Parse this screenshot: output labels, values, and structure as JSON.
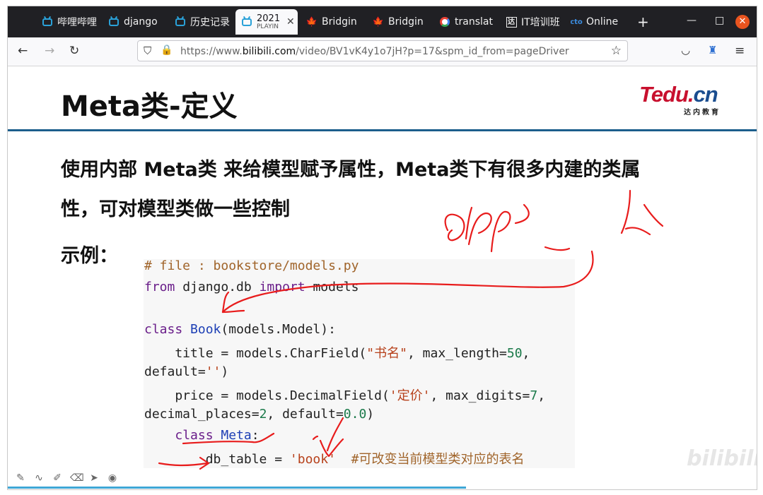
{
  "browser": {
    "tabs": [
      {
        "label": "哔哩哔哩",
        "icon": "bilibili-icon"
      },
      {
        "label": "django",
        "icon": "bilibili-icon"
      },
      {
        "label": "历史记录",
        "icon": "bilibili-icon"
      },
      {
        "label": "2021",
        "sublabel": "PLAYIN",
        "icon": "bilibili-icon",
        "active": true
      },
      {
        "label": "Bridgin",
        "icon": "maple-leaf-icon"
      },
      {
        "label": "Bridgin",
        "icon": "maple-leaf-icon"
      },
      {
        "label": "translat",
        "icon": "google-icon"
      },
      {
        "label": "IT培训班",
        "icon": "tarena-icon"
      },
      {
        "label": "Online",
        "icon": "cto-icon"
      }
    ],
    "new_tab": "+",
    "url_prefix": "https://www.",
    "url_domain": "bilibili.com",
    "url_path": "/video/BV1vK4y1o7jH?p=17&spm_id_from=pageDriver"
  },
  "slide": {
    "title": "Meta类-定义",
    "logo_main": "Tedu.",
    "logo_cn": "cn",
    "logo_sub": "达内教育",
    "para_line1": "使用内部 Meta类 来给模型赋予属性，Meta类下有很多内建的类属",
    "para_line2": "性，可对模型类做一些控制",
    "example_label": "示例：",
    "code": {
      "l1": "# file : bookstore/models.py",
      "l2_kw1": "from",
      "l2_mid": " django.db ",
      "l2_kw2": "import",
      "l2_end": " models",
      "l4_kw": "class",
      "l4_fn": "Book",
      "l4_end": "(models.Model):",
      "l5_a": "    title = models.CharField(",
      "l5_str": "\"书名\"",
      "l5_b": ", max_length=",
      "l5_num": "50",
      "l5_c": ",",
      "l6_a": "default=",
      "l6_str": "''",
      "l6_b": ")",
      "l7_a": "    price = models.DecimalField(",
      "l7_str": "'定价'",
      "l7_b": ", max_digits=",
      "l7_num": "7",
      "l7_c": ",",
      "l8_a": "decimal_places=",
      "l8_num1": "2",
      "l8_b": ", default=",
      "l8_num2": "0.0",
      "l8_c": ")",
      "l9_kw": "class",
      "l9_fn": "Meta",
      "l9_end": ":",
      "l10_a": "        db_table = ",
      "l10_str": "'book'",
      "l10_cm": "  #可改变当前模型类对应的表名"
    },
    "watermark": "bilibili"
  }
}
